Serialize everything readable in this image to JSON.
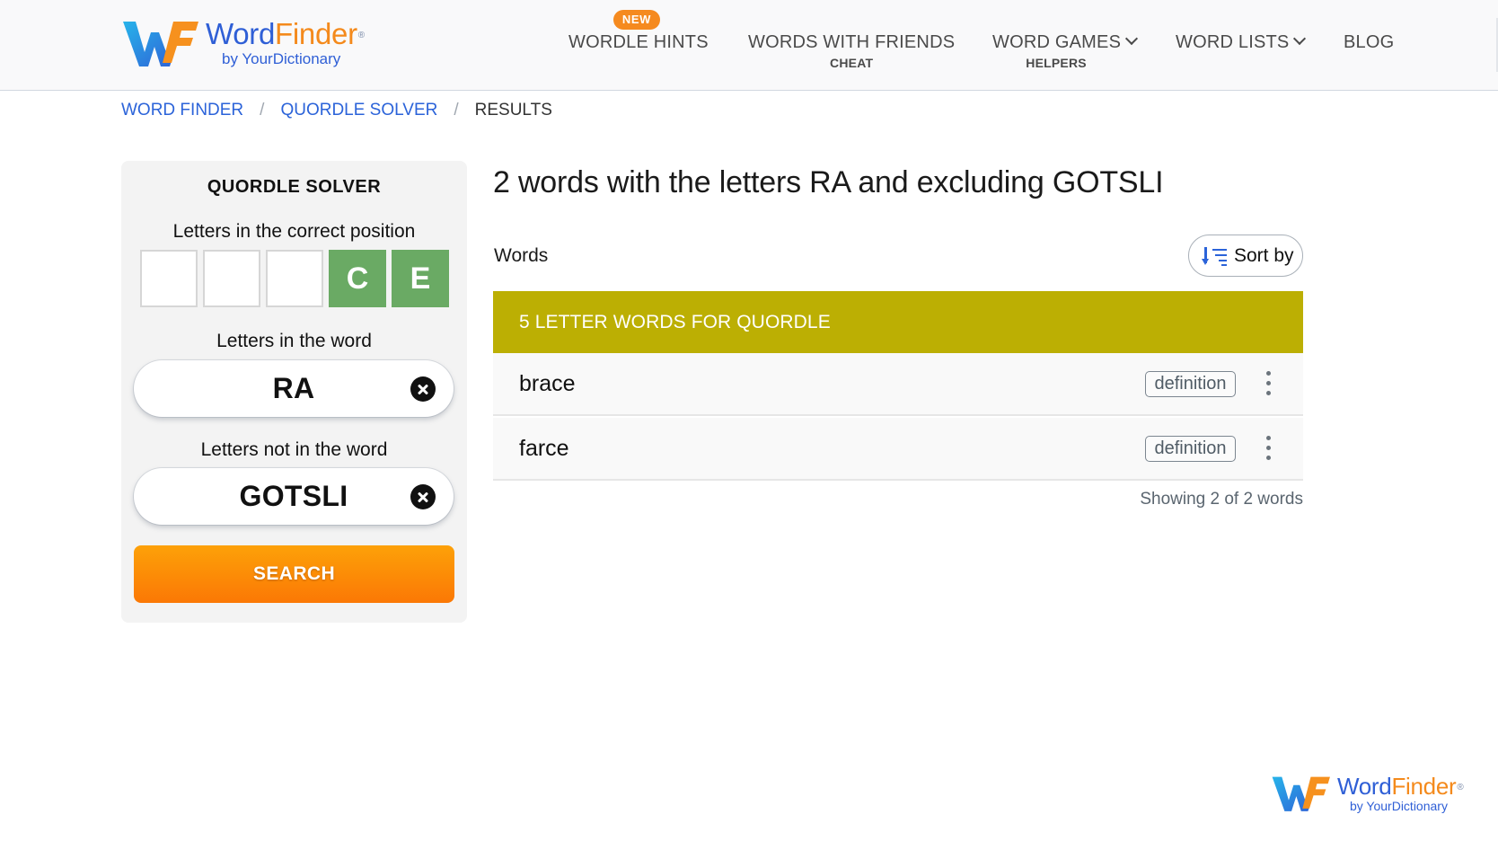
{
  "brand": {
    "name_part1": "Word",
    "name_part2": "Finder",
    "registered": "®",
    "tagline": "by YourDictionary",
    "colors": {
      "blue": "#2f5fd6",
      "orange": "#f48a1c"
    }
  },
  "nav": {
    "badge": "NEW",
    "items": [
      {
        "label": "WORDLE HINTS",
        "sub": ""
      },
      {
        "label": "WORDS WITH FRIENDS",
        "sub": "CHEAT"
      },
      {
        "label": "WORD GAMES",
        "sub": "HELPERS",
        "icon": "chevron-down-icon"
      },
      {
        "label": "WORD LISTS",
        "sub": "",
        "icon": "chevron-down-icon"
      },
      {
        "label": "BLOG",
        "sub": ""
      }
    ]
  },
  "breadcrumb": {
    "items": [
      {
        "label": "WORD FINDER",
        "link": true
      },
      {
        "label": "QUORDLE SOLVER",
        "link": true
      },
      {
        "label": "RESULTS",
        "link": false
      }
    ],
    "separator": "/"
  },
  "solver": {
    "title": "QUORDLE SOLVER",
    "position_label": "Letters in the correct position",
    "positions": [
      "",
      "",
      "",
      "C",
      "E"
    ],
    "tile_filled_color": "#6aaa64",
    "in_word_label": "Letters in the word",
    "in_word_value": "RA",
    "not_in_word_label": "Letters not in the word",
    "not_in_word_value": "GOTSLI",
    "search_label": "SEARCH"
  },
  "results": {
    "title": "2 words with the letters RA and excluding GOTSLI",
    "words_label": "Words",
    "sort_label": "Sort by",
    "section_title": "5 LETTER WORDS FOR QUORDLE",
    "section_color": "#bcaf03",
    "definition_label": "definition",
    "words": [
      "brace",
      "farce"
    ],
    "showing": "Showing 2 of 2 words"
  }
}
